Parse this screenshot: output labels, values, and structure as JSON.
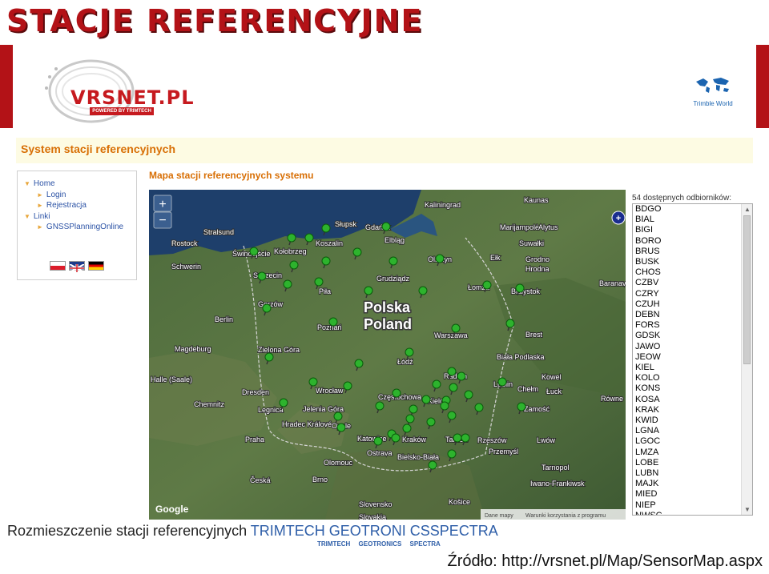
{
  "slide": {
    "title": "STACJE REFERENCYJNE",
    "caption_prefix": "Rozmieszczenie stacji referencyjnych",
    "caption_brands": "TRIMTECH GEOTRONI CSSPECTRA",
    "brand_strip": "TRIMTECH GEOTRONICS SPECTRA",
    "source": "Źródło: http://vrsnet.pl/Map/SensorMap.aspx"
  },
  "header": {
    "logo_text": "VRSNET.PL",
    "logo_sub": "POWERED BY TRIMTECH",
    "partner": "Trimble World"
  },
  "system_title": "System stacji referencyjnych",
  "menu": {
    "items": [
      {
        "label": "Home"
      },
      {
        "label": "Login"
      },
      {
        "label": "Rejestracja"
      },
      {
        "label": "Linki"
      },
      {
        "label": "GNSSPlanningOnline"
      }
    ]
  },
  "map": {
    "title": "Mapa stacji referencyjnych systemu",
    "zoom_in": "+",
    "zoom_out": "−",
    "country_label_pl": "Polska",
    "country_label_en": "Poland",
    "cities": [
      "Kaunas",
      "Kaliningrad",
      "Gdańsk",
      "Elbląg",
      "Olsztyn",
      "Słupsk",
      "Koszalin",
      "Kołobrzeg",
      "Stralsund",
      "Rostock",
      "Świnoujście",
      "Szczecin",
      "Schwerin",
      "Piła",
      "Grudziądz",
      "Łomża",
      "Białystok",
      "Gorzów",
      "Poznań",
      "Berlin",
      "Warszawa",
      "Magdeburg",
      "Zielona Góra",
      "Łódź",
      "Radom",
      "Lublin",
      "Halle (Saale)",
      "Dresden",
      "Wrocław",
      "Legnica",
      "Chemnitz",
      "Opole",
      "Częstochowa",
      "Kielce",
      "Jelenia Góra",
      "Zamość",
      "Katowice",
      "Kraków",
      "Tarnów",
      "Rzeszów",
      "Ostrava",
      "Praha",
      "Olomouc",
      "Bielsko-Biała",
      "Brno",
      "Przemyśl",
      "Marijampolė",
      "Alytus",
      "Suwałki",
      "Ełk",
      "Grodno",
      "Hrodna",
      "Brest",
      "Biała Podlaska",
      "Chełm",
      "Kowel",
      "Łuck",
      "Równe",
      "Lwów",
      "Tarnopol",
      "Iwano-Frankiwsk",
      "Košice",
      "Slovensko",
      "Slovakia",
      "Hradec Králové",
      "Česká",
      "Baranavichy"
    ],
    "footer_links": [
      "Dane mapy",
      "Warunki korzystania z programu"
    ],
    "google": "Google"
  },
  "receivers": {
    "title": "54 dostępnych odbiorników:",
    "items": [
      "BDGO",
      "BIAL",
      "BIGI",
      "BORO",
      "BRUS",
      "BUSK",
      "CHOS",
      "CZBV",
      "CZRY",
      "CZUH",
      "DEBN",
      "FORS",
      "GDSK",
      "JAWO",
      "JEOW",
      "KIEL",
      "KOLO",
      "KONS",
      "KOSA",
      "KRAK",
      "KWID",
      "LGNA",
      "LGOC",
      "LMZA",
      "LOBE",
      "LUBN",
      "MAJK",
      "MIED",
      "NIEP",
      "NWSC"
    ]
  },
  "colors": {
    "title_red": "#b31217",
    "orange_heading": "#d86f05",
    "link_blue": "#2b52a5",
    "marker_green": "#2db32d"
  }
}
